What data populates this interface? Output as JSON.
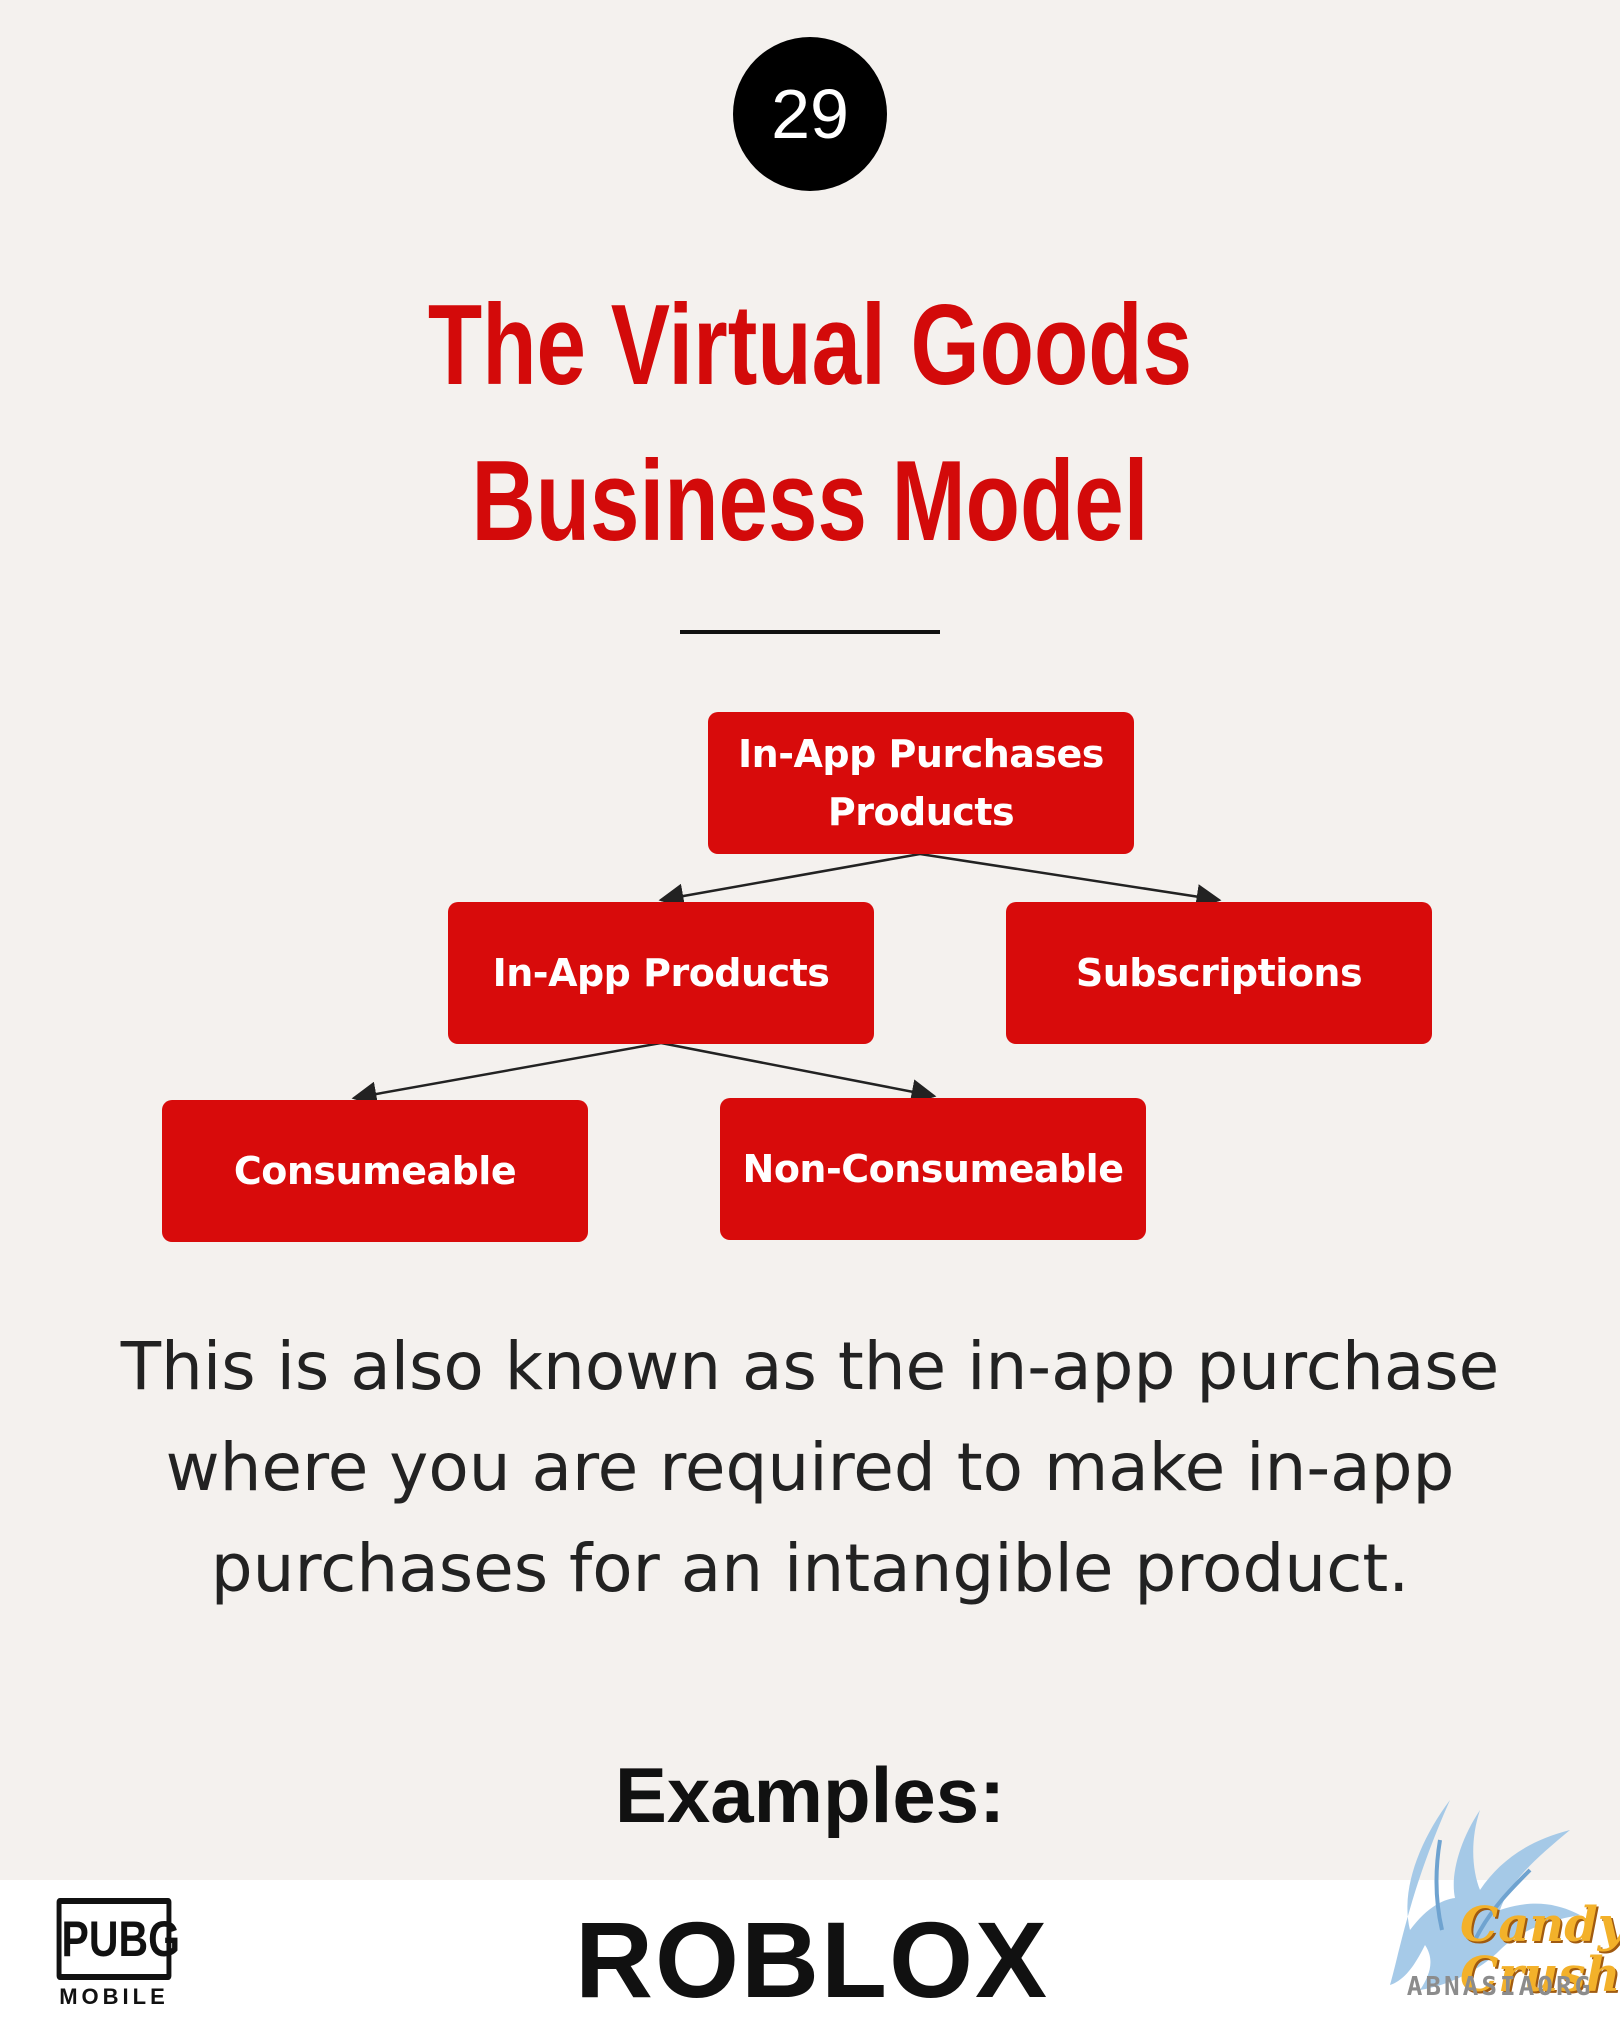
{
  "page_number": "29",
  "title": "The Virtual Goods Business Model",
  "diagram": {
    "root": "In-App Purchases Products",
    "children": [
      {
        "label": "In-App Products",
        "children": [
          "Consumeable",
          "Non-Consumeable"
        ]
      },
      {
        "label": "Subscriptions"
      }
    ]
  },
  "description": "This is also known as the in-app purchase where you are required to make in-app purchases for an intangible product.",
  "examples_heading": "Examples:",
  "logos": {
    "pubg": {
      "name": "PUBG",
      "sub": "MOBILE"
    },
    "roblox": "ROBLOX",
    "candy_crush": "Candy Crush"
  },
  "watermark": "ABNASIAORG",
  "colors": {
    "accent": "#d80b0b",
    "title": "#d30a0a",
    "background": "#f4f1ee"
  }
}
